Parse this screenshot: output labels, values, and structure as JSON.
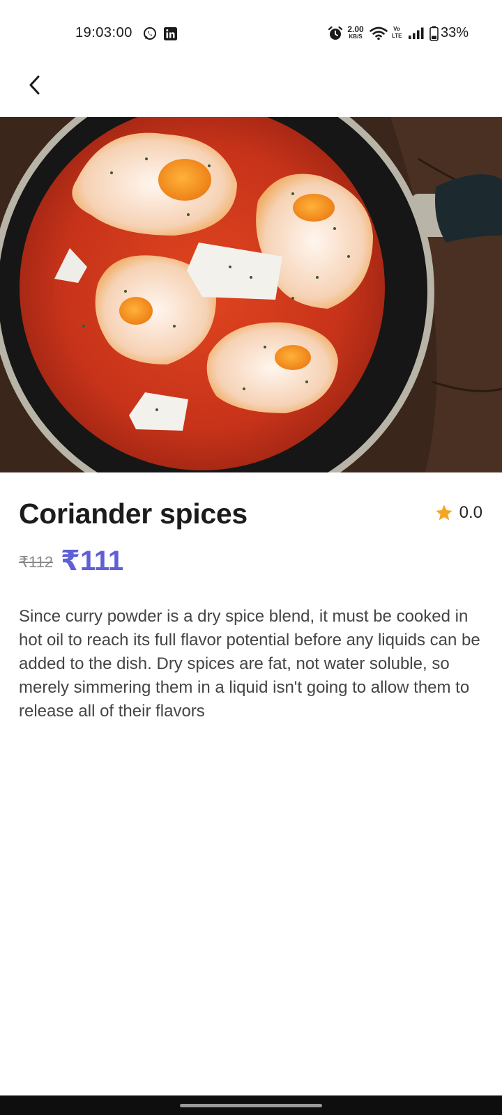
{
  "status_bar": {
    "time": "19:03:00",
    "net_speed_value": "2.00",
    "net_speed_unit": "KB/S",
    "volte_top": "Vo",
    "volte_bottom": "LTE",
    "battery": "33%",
    "icons": [
      "whatsapp-icon",
      "linkedin-icon",
      "alarm-icon",
      "wifi-icon",
      "signal-icon",
      "battery-icon"
    ]
  },
  "app_bar": {
    "back_icon": "chevron-left-icon"
  },
  "product": {
    "image": "shakshuka-pan-photo",
    "title": "Coriander spices",
    "rating": "0.0",
    "rating_icon": "star-icon",
    "rating_color": "#F5A524",
    "price_old": "₹112",
    "price_new": "₹111",
    "price_color": "#5F5FD6",
    "description": "Since curry powder is a dry spice blend, it must be cooked in hot oil to reach its full flavor potential before any liquids can be added to the dish. Dry spices are fat, not water soluble, so merely simmering them in a liquid isn't going to allow them to release all of their flavors"
  }
}
